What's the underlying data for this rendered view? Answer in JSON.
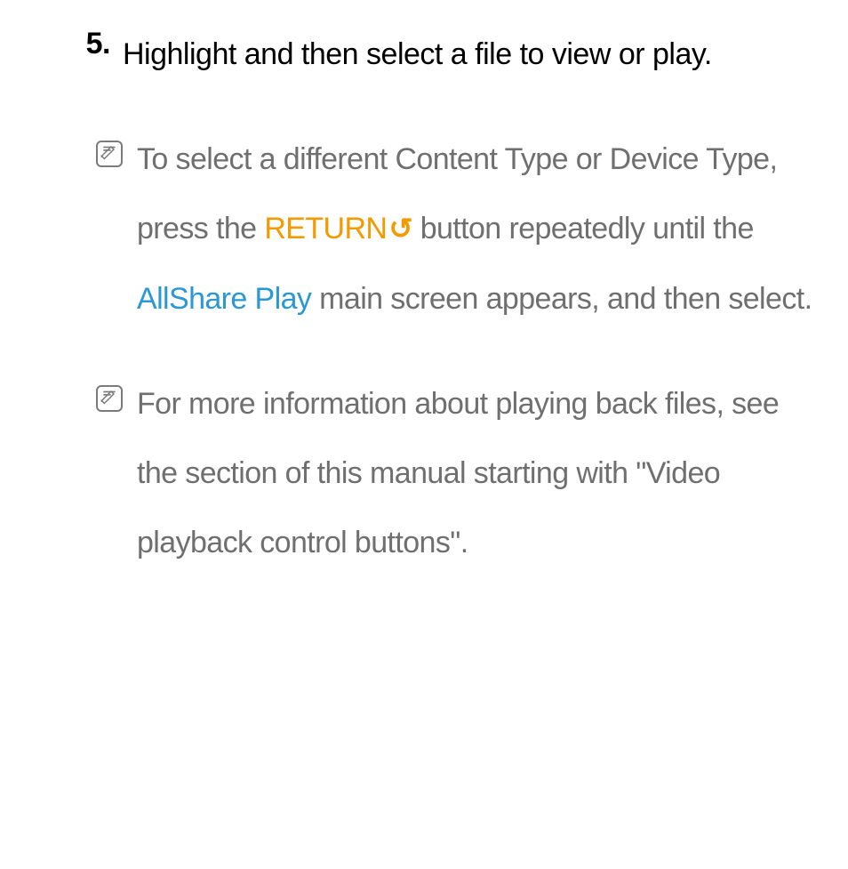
{
  "step": {
    "number": "5.",
    "text": "Highlight and then select a file to view or play."
  },
  "notes": [
    {
      "segments": [
        {
          "text": "To select a different Content Type or Device Type, press the "
        },
        {
          "text": "RETURN",
          "style": "orange"
        },
        {
          "text": "↺",
          "style": "orange-undo"
        },
        {
          "text": " button repeatedly until the "
        },
        {
          "text": "AllShare Play",
          "style": "blue"
        },
        {
          "text": " main screen appears, and then select."
        }
      ]
    },
    {
      "segments": [
        {
          "text": "For more information about playing back files, see the section of this manual starting with \"Video playback control buttons\"."
        }
      ]
    }
  ],
  "iconName": "note-icon"
}
